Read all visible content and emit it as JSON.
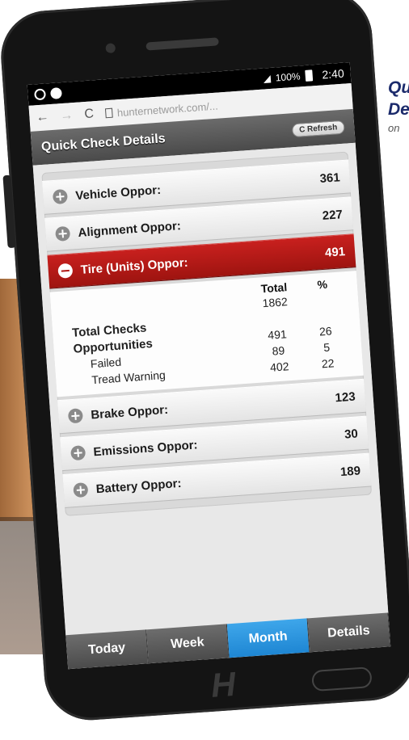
{
  "caption": {
    "line1": "Qu",
    "line2": "De",
    "line3": "on"
  },
  "status": {
    "battery": "100%",
    "time": "2:40"
  },
  "browser": {
    "url": "hunternetwork.com/...",
    "back": "←",
    "forward": "→",
    "reload": "C"
  },
  "header": {
    "title": "Quick Check Details",
    "refresh_label": "C Refresh"
  },
  "rows_top": [
    {
      "label": "Vehicle Oppor:",
      "value": "361"
    },
    {
      "label": "Alignment Oppor:",
      "value": "227"
    }
  ],
  "active_row": {
    "label": "Tire (Units) Oppor:",
    "value": "491"
  },
  "details": {
    "col_total": "Total",
    "col_pct": "%",
    "rows": [
      {
        "label": "",
        "total": "1862",
        "pct": ""
      },
      {
        "label": "Total Checks",
        "total": "",
        "pct": ""
      },
      {
        "label": "Opportunities",
        "total": "491",
        "pct": "26"
      },
      {
        "label": "Failed",
        "total": "89",
        "pct": "5"
      },
      {
        "label": "Tread Warning",
        "total": "402",
        "pct": "22"
      }
    ]
  },
  "rows_bottom": [
    {
      "label": "Brake Oppor:",
      "value": "123"
    },
    {
      "label": "Emissions Oppor:",
      "value": "30"
    },
    {
      "label": "Battery Oppor:",
      "value": "189"
    }
  ],
  "tabs": [
    {
      "label": "Today"
    },
    {
      "label": "Week"
    },
    {
      "label": "Month",
      "active": true
    },
    {
      "label": "Details"
    }
  ],
  "home": {
    "logo": "H"
  },
  "colors": {
    "active_row": "#b01815",
    "active_tab": "#2a96df"
  }
}
